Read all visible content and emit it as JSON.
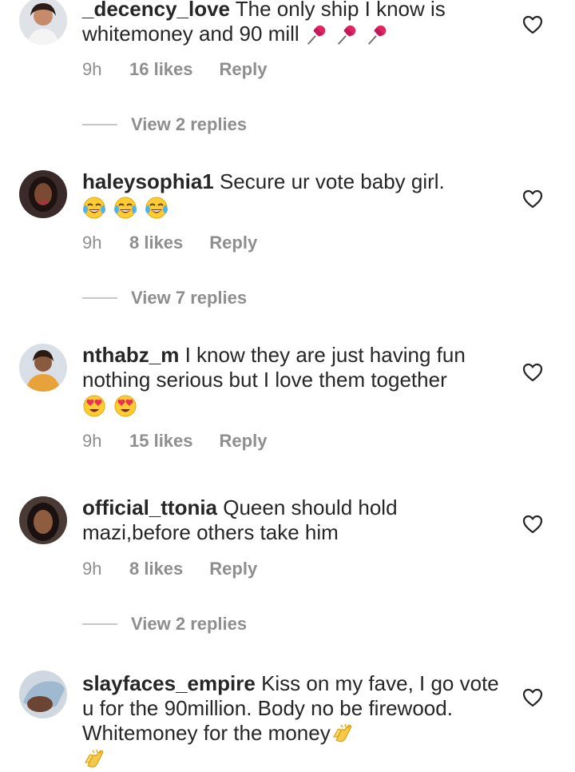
{
  "comments": [
    {
      "username": "_decency_love",
      "text": "The only ship I know is whitemoney and 90 mill",
      "emoji": [
        "pushpin",
        "pushpin",
        "pushpin"
      ],
      "time": "9h",
      "likes": "16 likes",
      "reply": "Reply",
      "view_replies": "View 2 replies"
    },
    {
      "username": "haleysophia1",
      "text": "Secure ur vote baby girl.",
      "emoji": [
        "tears-of-joy",
        "tears-of-joy",
        "tears-of-joy"
      ],
      "time": "9h",
      "likes": "8 likes",
      "reply": "Reply",
      "view_replies": "View 7 replies"
    },
    {
      "username": "nthabz_m",
      "text": "I know they are just having fun nothing serious but I love them together",
      "emoji": [
        "heart-eyes",
        "heart-eyes"
      ],
      "time": "9h",
      "likes": "15 likes",
      "reply": "Reply"
    },
    {
      "username": "official_ttonia",
      "text": "Queen should hold mazi,before others take him",
      "time": "9h",
      "likes": "8 likes",
      "reply": "Reply",
      "view_replies": "View 2 replies"
    },
    {
      "username": "slayfaces_empire",
      "text": "Kiss on my fave, I go vote u for the 90million. Body no be firewood. Whitemoney for the money",
      "emoji": [
        "clapping-hands",
        "clapping-hands"
      ]
    }
  ],
  "colors": {
    "text": "#262626",
    "meta": "#8e8e8e",
    "divider": "#c7c7c7",
    "background": "#ffffff"
  },
  "icons": {
    "like": "heart-outline-icon"
  }
}
